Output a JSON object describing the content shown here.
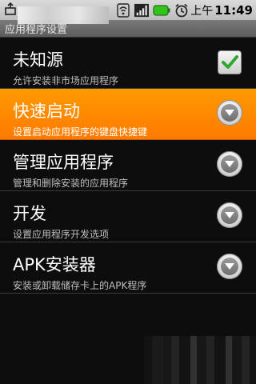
{
  "status_bar": {
    "left_icon": "usb-debug-icon",
    "icons": [
      "wifi-icon",
      "signal-icon",
      "battery-icon",
      "alarm-icon"
    ],
    "ampm": "上午",
    "time": "11:49"
  },
  "title_bar": {
    "title": "应用程序设置"
  },
  "settings": [
    {
      "title": "未知源",
      "subtitle": "允许安装非市场应用程序",
      "control": "checkbox",
      "checked": true
    },
    {
      "title": "快速启动",
      "subtitle": "设置启动应用程序的键盘快捷键",
      "control": "dropdown",
      "highlighted": true
    },
    {
      "title": "管理应用程序",
      "subtitle": "管理和删除安装的应用程序",
      "control": "dropdown"
    },
    {
      "title": "开发",
      "subtitle": "设置应用程序开发选项",
      "control": "dropdown"
    },
    {
      "title": "APK安装器",
      "subtitle": "安装或卸载储存卡上的APK程序",
      "control": "dropdown"
    }
  ],
  "colors": {
    "highlight": "#ff8a00",
    "check": "#2ea82e"
  }
}
